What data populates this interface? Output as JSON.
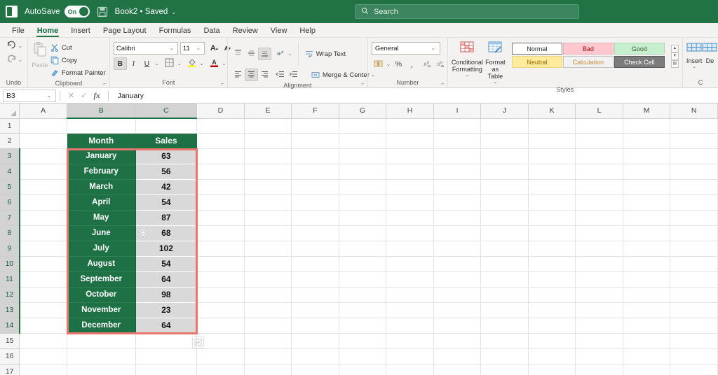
{
  "titlebar": {
    "app_icon": "excel-logo-icon",
    "autosave_label": "AutoSave",
    "autosave_state": "On",
    "save_icon": "save-icon",
    "document_title": "Book2  •  Saved",
    "caret": "⌄"
  },
  "search": {
    "icon": "search-icon",
    "placeholder": "Search"
  },
  "tabs": [
    {
      "label": "File",
      "active": false
    },
    {
      "label": "Home",
      "active": true
    },
    {
      "label": "Insert",
      "active": false
    },
    {
      "label": "Page Layout",
      "active": false
    },
    {
      "label": "Formulas",
      "active": false
    },
    {
      "label": "Data",
      "active": false
    },
    {
      "label": "Review",
      "active": false
    },
    {
      "label": "View",
      "active": false
    },
    {
      "label": "Help",
      "active": false
    }
  ],
  "ribbon": {
    "undo": {
      "group_label": "Undo",
      "undo_icon": "undo-arrow-icon",
      "redo_icon": "redo-arrow-icon",
      "caret": "⌄"
    },
    "clipboard": {
      "group_label": "Clipboard",
      "paste_label": "Paste",
      "paste_icon": "paste-clipboard-icon",
      "cut_label": "Cut",
      "cut_icon": "scissors-icon",
      "copy_label": "Copy",
      "copy_icon": "copy-pages-icon",
      "format_painter_label": "Format Painter",
      "format_painter_icon": "paintbrush-icon",
      "dialog_launcher": "⌐"
    },
    "font": {
      "group_label": "Font",
      "font_name": "Calibri",
      "font_size": "11",
      "grow_font": "A",
      "shrink_font": "A",
      "bold": "B",
      "italic": "I",
      "underline": "U",
      "borders_icon": "borders-icon",
      "fill_color_icon": "fill-color-icon",
      "font_color_icon": "font-color-icon",
      "caret": "⌄",
      "dialog_launcher": "⌐"
    },
    "alignment": {
      "group_label": "Alignment",
      "align_top_icon": "align-top-icon",
      "align_middle_icon": "align-middle-icon",
      "align_bottom_icon": "align-bottom-icon",
      "orientation_icon": "text-orientation-icon",
      "align_left_icon": "align-left-icon",
      "align_center_icon": "align-center-icon",
      "align_right_icon": "align-right-icon",
      "decrease_indent_icon": "decrease-indent-icon",
      "increase_indent_icon": "increase-indent-icon",
      "wrap_text_label": "Wrap Text",
      "wrap_text_icon": "wrap-text-icon",
      "merge_center_label": "Merge & Center",
      "merge_center_icon": "merge-center-icon",
      "caret": "⌄",
      "dialog_launcher": "⌐"
    },
    "number": {
      "group_label": "Number",
      "format_value": "General",
      "accounting_icon": "accounting-format-icon",
      "percent_label": "%",
      "comma_label": ",",
      "increase_decimal_icon": "increase-decimal-icon",
      "decrease_decimal_icon": "decrease-decimal-icon",
      "caret": "⌄",
      "dialog_launcher": "⌐"
    },
    "styles": {
      "group_label": "Styles",
      "conditional_formatting_label": "Conditional\nFormatting",
      "conditional_formatting_icon": "conditional-formatting-icon",
      "format_as_table_label": "Format as\nTable",
      "format_as_table_icon": "format-as-table-icon",
      "gallery": [
        {
          "label": "Normal",
          "kind": "normal"
        },
        {
          "label": "Bad",
          "kind": "bad"
        },
        {
          "label": "Good",
          "kind": "good"
        },
        {
          "label": "Neutral",
          "kind": "neutral"
        },
        {
          "label": "Calculation",
          "kind": "calc"
        },
        {
          "label": "Check Cell",
          "kind": "check"
        }
      ],
      "scroll_up": "▲",
      "scroll_down": "▼",
      "scroll_more": "▤",
      "caret": "⌄"
    },
    "cells": {
      "group_label": "C",
      "insert_label": "Insert",
      "insert_icon": "insert-cells-icon",
      "delete_label": "De",
      "delete_icon": "delete-cells-icon",
      "caret": "⌄"
    }
  },
  "formula_bar": {
    "name_box_value": "B3",
    "name_box_caret": "⌄",
    "cancel_icon": "cancel-x-icon",
    "enter_icon": "confirm-check-icon",
    "function_icon": "fx",
    "formula_value": "January"
  },
  "grid": {
    "select_all_icon": "select-all-corner-icon",
    "column_headers": [
      "A",
      "B",
      "C",
      "D",
      "E",
      "F",
      "G",
      "H",
      "I",
      "J",
      "K",
      "L",
      "M",
      "N"
    ],
    "selected_columns": [
      "B",
      "C"
    ],
    "row_headers": [
      "1",
      "2",
      "3",
      "4",
      "5",
      "6",
      "7",
      "8",
      "9",
      "10",
      "11",
      "12",
      "13",
      "14",
      "15",
      "16",
      "17"
    ],
    "selected_rows": [
      "3",
      "4",
      "5",
      "6",
      "7",
      "8",
      "9",
      "10",
      "11",
      "12",
      "13",
      "14"
    ],
    "table_header": {
      "month": "Month",
      "sales": "Sales"
    },
    "rows": [
      {
        "row": "3",
        "month": "January",
        "sales": "63"
      },
      {
        "row": "4",
        "month": "February",
        "sales": "56"
      },
      {
        "row": "5",
        "month": "March",
        "sales": "42"
      },
      {
        "row": "6",
        "month": "April",
        "sales": "54"
      },
      {
        "row": "7",
        "month": "May",
        "sales": "87"
      },
      {
        "row": "8",
        "month": "June",
        "sales": "68"
      },
      {
        "row": "9",
        "month": "July",
        "sales": "102"
      },
      {
        "row": "10",
        "month": "August",
        "sales": "54"
      },
      {
        "row": "11",
        "month": "September",
        "sales": "64"
      },
      {
        "row": "12",
        "month": "October",
        "sales": "98"
      },
      {
        "row": "13",
        "month": "November",
        "sales": "23"
      },
      {
        "row": "14",
        "month": "December",
        "sales": "64"
      }
    ],
    "selection_range": "B3:C14",
    "quick_analysis_icon": "quick-analysis-icon",
    "mouse_cursor_icon": "move-cursor-icon"
  },
  "colors": {
    "brand_green": "#217346",
    "table_green": "#1e7145",
    "value_gray": "#d9d9d9",
    "selection_red": "#e8766d",
    "ribbon_gray": "#f3f2f1"
  }
}
